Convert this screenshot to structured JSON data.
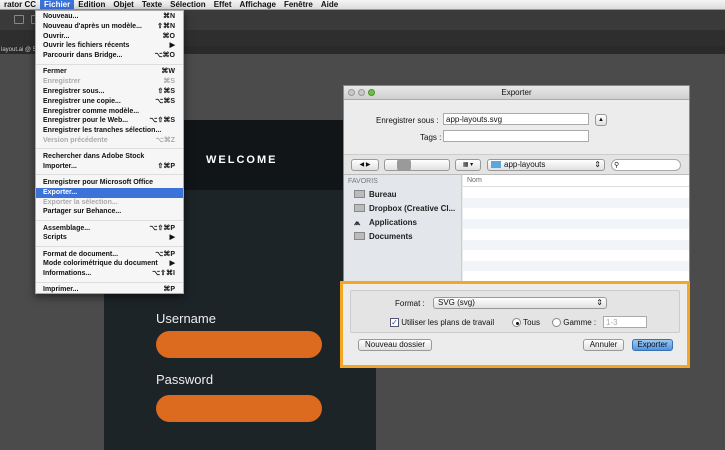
{
  "menubar": {
    "items": [
      "rator CC",
      "Fichier",
      "Edition",
      "Objet",
      "Texte",
      "Sélection",
      "Effet",
      "Affichage",
      "Fenêtre",
      "Aide"
    ],
    "active": "Fichier"
  },
  "doc_tab": "layout.ai @ 50",
  "artboard": {
    "title": "WELCOME",
    "username_label": "Username",
    "password_label": "Password",
    "field_color": "#dc6b1f"
  },
  "file_menu": [
    [
      {
        "label": "Nouveau...",
        "shortcut": "⌘N"
      },
      {
        "label": "Nouveau d'après un modèle...",
        "shortcut": "⇧⌘N"
      },
      {
        "label": "Ouvrir...",
        "shortcut": "⌘O"
      },
      {
        "label": "Ouvrir les fichiers récents",
        "shortcut": "▶"
      },
      {
        "label": "Parcourir dans Bridge...",
        "shortcut": "⌥⌘O"
      }
    ],
    [
      {
        "label": "Fermer",
        "shortcut": "⌘W"
      },
      {
        "label": "Enregistrer",
        "shortcut": "⌘S",
        "disabled": true
      },
      {
        "label": "Enregistrer sous...",
        "shortcut": "⇧⌘S"
      },
      {
        "label": "Enregistrer une copie...",
        "shortcut": "⌥⌘S"
      },
      {
        "label": "Enregistrer comme modèle...",
        "shortcut": ""
      },
      {
        "label": "Enregistrer pour le Web...",
        "shortcut": "⌥⇧⌘S"
      },
      {
        "label": "Enregistrer les tranches sélection...",
        "shortcut": ""
      },
      {
        "label": "Version précédente",
        "shortcut": "⌥⌘Z",
        "disabled": true
      }
    ],
    [
      {
        "label": "Rechercher dans Adobe Stock",
        "shortcut": ""
      },
      {
        "label": "Importer...",
        "shortcut": "⇧⌘P"
      }
    ],
    [
      {
        "label": "Enregistrer pour Microsoft Office",
        "shortcut": ""
      },
      {
        "label": "Exporter...",
        "shortcut": "",
        "selected": true
      },
      {
        "label": "Exporter la sélection...",
        "shortcut": "",
        "disabled": true
      },
      {
        "label": "Partager sur Behance...",
        "shortcut": ""
      }
    ],
    [
      {
        "label": "Assemblage...",
        "shortcut": "⌥⇧⌘P"
      },
      {
        "label": "Scripts",
        "shortcut": "▶"
      }
    ],
    [
      {
        "label": "Format de document...",
        "shortcut": "⌥⌘P"
      },
      {
        "label": "Mode colorimétrique du document",
        "shortcut": "▶"
      },
      {
        "label": "Informations...",
        "shortcut": "⌥⇧⌘I"
      }
    ],
    [
      {
        "label": "Imprimer...",
        "shortcut": "⌘P"
      }
    ]
  ],
  "dialog": {
    "title": "Exporter",
    "save_as_label": "Enregistrer sous :",
    "save_as_value": "app-layouts.svg",
    "tags_label": "Tags :",
    "tags_value": "",
    "location": "app-layouts",
    "sidebar_header": "FAVORIS",
    "sidebar_items": [
      "Bureau",
      "Dropbox (Creative Cl...",
      "Applications",
      "Documents"
    ],
    "column_name": "Nom",
    "format_label": "Format :",
    "format_value": "SVG (svg)",
    "use_artboards_label": "Utiliser les plans de travail",
    "use_artboards_checked": true,
    "all_label": "Tous",
    "range_label": "Gamme :",
    "range_placeholder": "1-3",
    "range_selected": "Tous",
    "new_folder": "Nouveau dossier",
    "cancel": "Annuler",
    "export": "Exporter",
    "highlight_color": "#f5a623"
  }
}
